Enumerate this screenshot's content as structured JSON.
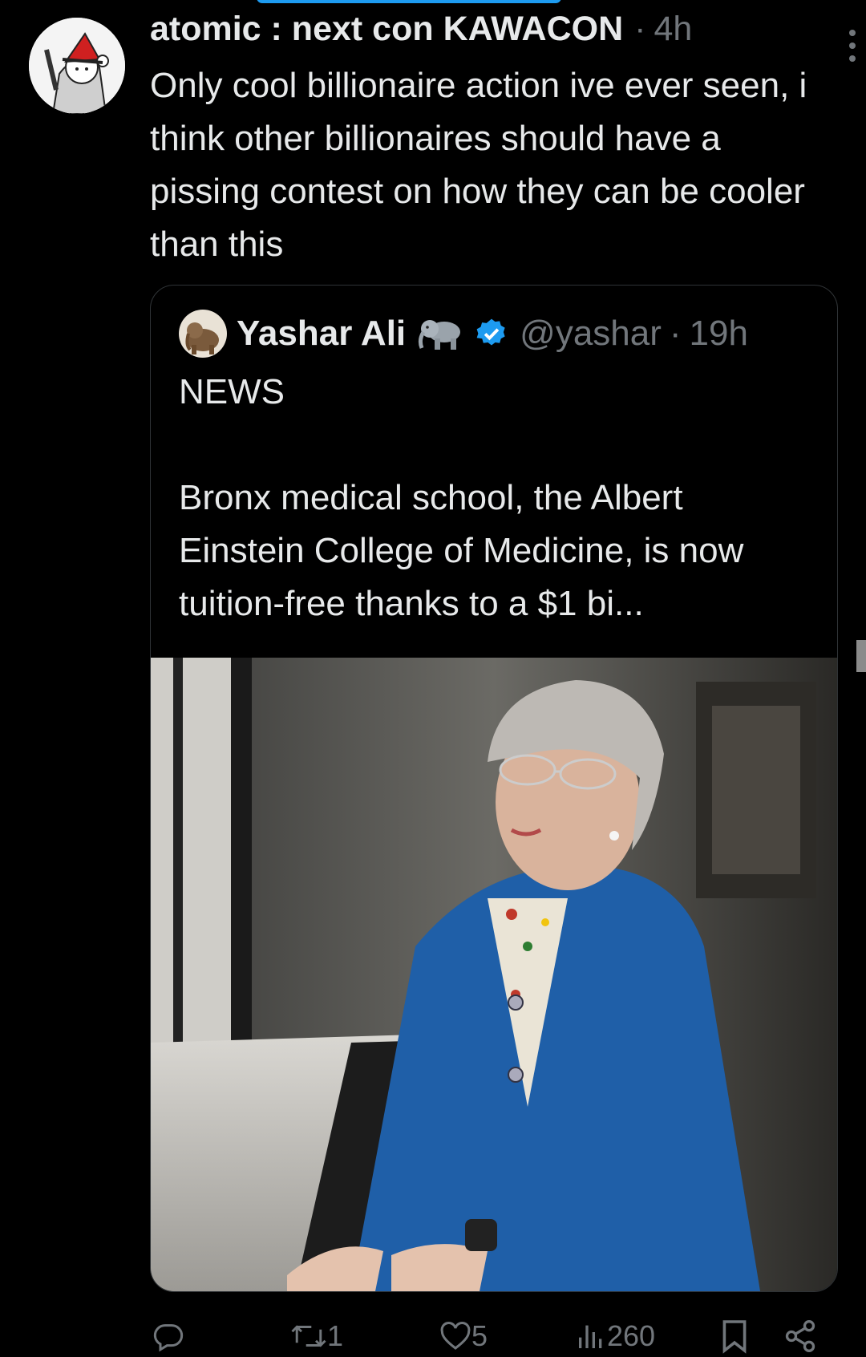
{
  "tweet": {
    "author_display_name": "atomic : next con KAWACON",
    "separator": "·",
    "timestamp": "4h",
    "text": "Only cool billionaire action ive ever seen, i think other billionaires should have a pissing contest on how they can be cooler than this"
  },
  "quoted_tweet": {
    "author_display_name": "Yashar Ali",
    "handle": "@yashar",
    "separator": "·",
    "timestamp": "19h",
    "text": "NEWS\n\nBronx medical school, the Albert Einstein College of Medicine, is now tuition-free thanks to a $1 bi..."
  },
  "actions": {
    "reply_count": "",
    "retweet_count": "1",
    "like_count": "5",
    "view_count": "260"
  },
  "icons": [
    "more-icon",
    "elephant-emoji-icon",
    "verified-badge-icon",
    "reply-icon",
    "retweet-icon",
    "like-icon",
    "views-icon",
    "bookmark-icon",
    "share-icon"
  ],
  "colors": {
    "background": "#000000",
    "text": "#e7e9ea",
    "muted": "#71767b",
    "verified": "#1d9bf0",
    "jacket_blue": "#1f5fa8"
  }
}
